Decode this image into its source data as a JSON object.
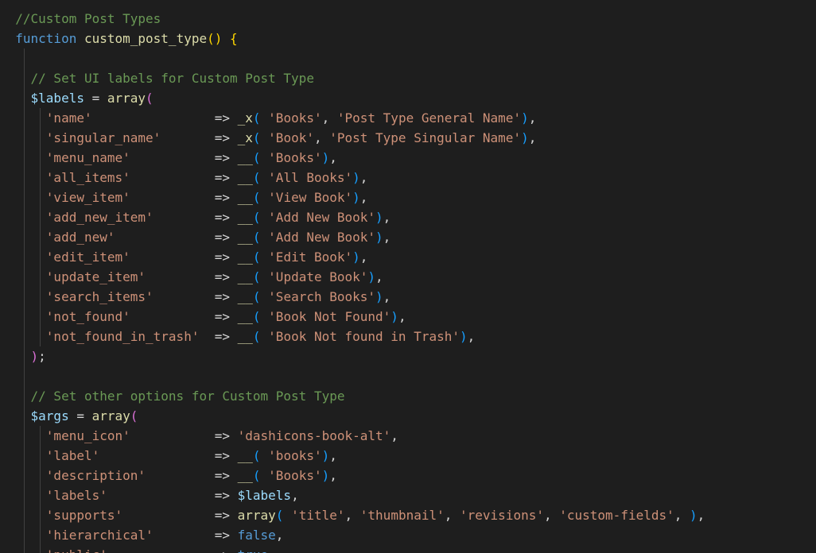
{
  "colors": {
    "background": "#1e1e1e",
    "comment": "#6a9955",
    "keyword": "#569cd6",
    "function": "#dcdcaa",
    "string": "#ce9178",
    "variable": "#9cdcfe",
    "plain": "#d4d4d4",
    "bracket_level1": "#ffd700",
    "bracket_level2": "#da70d6",
    "bracket_level3": "#179fff",
    "indent_guide": "#404040"
  },
  "lines": [
    {
      "guides": 0,
      "tokens": [
        {
          "t": "  "
        },
        {
          "t": "//Custom Post Types",
          "c": "comment"
        }
      ]
    },
    {
      "guides": 0,
      "tokens": [
        {
          "t": "  "
        },
        {
          "t": "function",
          "c": "kw"
        },
        {
          "t": " "
        },
        {
          "t": "custom_post_type",
          "c": "fn"
        },
        {
          "t": "()",
          "c": "b1"
        },
        {
          "t": " "
        },
        {
          "t": "{",
          "c": "b1"
        }
      ]
    },
    {
      "guides": 1,
      "tokens": [
        {
          "t": ""
        }
      ]
    },
    {
      "guides": 1,
      "tokens": [
        {
          "t": "    "
        },
        {
          "t": "// Set UI labels for Custom Post Type",
          "c": "comment"
        }
      ]
    },
    {
      "guides": 1,
      "tokens": [
        {
          "t": "    "
        },
        {
          "t": "$labels",
          "c": "var"
        },
        {
          "t": " = "
        },
        {
          "t": "array",
          "c": "fn"
        },
        {
          "t": "(",
          "c": "b2"
        }
      ]
    },
    {
      "guides": 2,
      "tokens": [
        {
          "t": "      "
        },
        {
          "t": "'name'",
          "c": "str"
        },
        {
          "t": "                => "
        },
        {
          "t": "_x",
          "c": "fn"
        },
        {
          "t": "(",
          "c": "b3"
        },
        {
          "t": " "
        },
        {
          "t": "'Books'",
          "c": "str"
        },
        {
          "t": ", "
        },
        {
          "t": "'Post Type General Name'",
          "c": "str"
        },
        {
          "t": ")",
          "c": "b3"
        },
        {
          "t": ","
        }
      ]
    },
    {
      "guides": 2,
      "tokens": [
        {
          "t": "      "
        },
        {
          "t": "'singular_name'",
          "c": "str"
        },
        {
          "t": "       => "
        },
        {
          "t": "_x",
          "c": "fn"
        },
        {
          "t": "(",
          "c": "b3"
        },
        {
          "t": " "
        },
        {
          "t": "'Book'",
          "c": "str"
        },
        {
          "t": ", "
        },
        {
          "t": "'Post Type Singular Name'",
          "c": "str"
        },
        {
          "t": ")",
          "c": "b3"
        },
        {
          "t": ","
        }
      ]
    },
    {
      "guides": 2,
      "tokens": [
        {
          "t": "      "
        },
        {
          "t": "'menu_name'",
          "c": "str"
        },
        {
          "t": "           => "
        },
        {
          "t": "__",
          "c": "fn"
        },
        {
          "t": "(",
          "c": "b3"
        },
        {
          "t": " "
        },
        {
          "t": "'Books'",
          "c": "str"
        },
        {
          "t": ")",
          "c": "b3"
        },
        {
          "t": ","
        }
      ]
    },
    {
      "guides": 2,
      "tokens": [
        {
          "t": "      "
        },
        {
          "t": "'all_items'",
          "c": "str"
        },
        {
          "t": "           => "
        },
        {
          "t": "__",
          "c": "fn"
        },
        {
          "t": "(",
          "c": "b3"
        },
        {
          "t": " "
        },
        {
          "t": "'All Books'",
          "c": "str"
        },
        {
          "t": ")",
          "c": "b3"
        },
        {
          "t": ","
        }
      ]
    },
    {
      "guides": 2,
      "tokens": [
        {
          "t": "      "
        },
        {
          "t": "'view_item'",
          "c": "str"
        },
        {
          "t": "           => "
        },
        {
          "t": "__",
          "c": "fn"
        },
        {
          "t": "(",
          "c": "b3"
        },
        {
          "t": " "
        },
        {
          "t": "'View Book'",
          "c": "str"
        },
        {
          "t": ")",
          "c": "b3"
        },
        {
          "t": ","
        }
      ]
    },
    {
      "guides": 2,
      "tokens": [
        {
          "t": "      "
        },
        {
          "t": "'add_new_item'",
          "c": "str"
        },
        {
          "t": "        => "
        },
        {
          "t": "__",
          "c": "fn"
        },
        {
          "t": "(",
          "c": "b3"
        },
        {
          "t": " "
        },
        {
          "t": "'Add New Book'",
          "c": "str"
        },
        {
          "t": ")",
          "c": "b3"
        },
        {
          "t": ","
        }
      ]
    },
    {
      "guides": 2,
      "tokens": [
        {
          "t": "      "
        },
        {
          "t": "'add_new'",
          "c": "str"
        },
        {
          "t": "             => "
        },
        {
          "t": "__",
          "c": "fn"
        },
        {
          "t": "(",
          "c": "b3"
        },
        {
          "t": " "
        },
        {
          "t": "'Add New Book'",
          "c": "str"
        },
        {
          "t": ")",
          "c": "b3"
        },
        {
          "t": ","
        }
      ]
    },
    {
      "guides": 2,
      "tokens": [
        {
          "t": "      "
        },
        {
          "t": "'edit_item'",
          "c": "str"
        },
        {
          "t": "           => "
        },
        {
          "t": "__",
          "c": "fn"
        },
        {
          "t": "(",
          "c": "b3"
        },
        {
          "t": " "
        },
        {
          "t": "'Edit Book'",
          "c": "str"
        },
        {
          "t": ")",
          "c": "b3"
        },
        {
          "t": ","
        }
      ]
    },
    {
      "guides": 2,
      "tokens": [
        {
          "t": "      "
        },
        {
          "t": "'update_item'",
          "c": "str"
        },
        {
          "t": "         => "
        },
        {
          "t": "__",
          "c": "fn"
        },
        {
          "t": "(",
          "c": "b3"
        },
        {
          "t": " "
        },
        {
          "t": "'Update Book'",
          "c": "str"
        },
        {
          "t": ")",
          "c": "b3"
        },
        {
          "t": ","
        }
      ]
    },
    {
      "guides": 2,
      "tokens": [
        {
          "t": "      "
        },
        {
          "t": "'search_items'",
          "c": "str"
        },
        {
          "t": "        => "
        },
        {
          "t": "__",
          "c": "fn"
        },
        {
          "t": "(",
          "c": "b3"
        },
        {
          "t": " "
        },
        {
          "t": "'Search Books'",
          "c": "str"
        },
        {
          "t": ")",
          "c": "b3"
        },
        {
          "t": ","
        }
      ]
    },
    {
      "guides": 2,
      "tokens": [
        {
          "t": "      "
        },
        {
          "t": "'not_found'",
          "c": "str"
        },
        {
          "t": "           => "
        },
        {
          "t": "__",
          "c": "fn"
        },
        {
          "t": "(",
          "c": "b3"
        },
        {
          "t": " "
        },
        {
          "t": "'Book Not Found'",
          "c": "str"
        },
        {
          "t": ")",
          "c": "b3"
        },
        {
          "t": ","
        }
      ]
    },
    {
      "guides": 2,
      "tokens": [
        {
          "t": "      "
        },
        {
          "t": "'not_found_in_trash'",
          "c": "str"
        },
        {
          "t": "  => "
        },
        {
          "t": "__",
          "c": "fn"
        },
        {
          "t": "(",
          "c": "b3"
        },
        {
          "t": " "
        },
        {
          "t": "'Book Not found in Trash'",
          "c": "str"
        },
        {
          "t": ")",
          "c": "b3"
        },
        {
          "t": ","
        }
      ]
    },
    {
      "guides": 1,
      "tokens": [
        {
          "t": "    "
        },
        {
          "t": ")",
          "c": "b2"
        },
        {
          "t": ";"
        }
      ]
    },
    {
      "guides": 1,
      "tokens": [
        {
          "t": ""
        }
      ]
    },
    {
      "guides": 1,
      "tokens": [
        {
          "t": "    "
        },
        {
          "t": "// Set other options for Custom Post Type",
          "c": "comment"
        }
      ]
    },
    {
      "guides": 1,
      "tokens": [
        {
          "t": "    "
        },
        {
          "t": "$args",
          "c": "var"
        },
        {
          "t": " = "
        },
        {
          "t": "array",
          "c": "fn"
        },
        {
          "t": "(",
          "c": "b2"
        }
      ]
    },
    {
      "guides": 2,
      "tokens": [
        {
          "t": "      "
        },
        {
          "t": "'menu_icon'",
          "c": "str"
        },
        {
          "t": "           => "
        },
        {
          "t": "'dashicons-book-alt'",
          "c": "str"
        },
        {
          "t": ","
        }
      ]
    },
    {
      "guides": 2,
      "tokens": [
        {
          "t": "      "
        },
        {
          "t": "'label'",
          "c": "str"
        },
        {
          "t": "               => "
        },
        {
          "t": "__",
          "c": "fn"
        },
        {
          "t": "(",
          "c": "b3"
        },
        {
          "t": " "
        },
        {
          "t": "'books'",
          "c": "str"
        },
        {
          "t": ")",
          "c": "b3"
        },
        {
          "t": ","
        }
      ]
    },
    {
      "guides": 2,
      "tokens": [
        {
          "t": "      "
        },
        {
          "t": "'description'",
          "c": "str"
        },
        {
          "t": "         => "
        },
        {
          "t": "__",
          "c": "fn"
        },
        {
          "t": "(",
          "c": "b3"
        },
        {
          "t": " "
        },
        {
          "t": "'Books'",
          "c": "str"
        },
        {
          "t": ")",
          "c": "b3"
        },
        {
          "t": ","
        }
      ]
    },
    {
      "guides": 2,
      "tokens": [
        {
          "t": "      "
        },
        {
          "t": "'labels'",
          "c": "str"
        },
        {
          "t": "              => "
        },
        {
          "t": "$labels",
          "c": "var"
        },
        {
          "t": ","
        }
      ]
    },
    {
      "guides": 2,
      "tokens": [
        {
          "t": "      "
        },
        {
          "t": "'supports'",
          "c": "str"
        },
        {
          "t": "            => "
        },
        {
          "t": "array",
          "c": "fn"
        },
        {
          "t": "(",
          "c": "b3"
        },
        {
          "t": " "
        },
        {
          "t": "'title'",
          "c": "str"
        },
        {
          "t": ", "
        },
        {
          "t": "'thumbnail'",
          "c": "str"
        },
        {
          "t": ", "
        },
        {
          "t": "'revisions'",
          "c": "str"
        },
        {
          "t": ", "
        },
        {
          "t": "'custom-fields'",
          "c": "str"
        },
        {
          "t": ", "
        },
        {
          "t": ")",
          "c": "b3"
        },
        {
          "t": ","
        }
      ]
    },
    {
      "guides": 2,
      "tokens": [
        {
          "t": "      "
        },
        {
          "t": "'hierarchical'",
          "c": "str"
        },
        {
          "t": "        => "
        },
        {
          "t": "false",
          "c": "kw"
        },
        {
          "t": ","
        }
      ]
    },
    {
      "guides": 2,
      "tokens": [
        {
          "t": "      "
        },
        {
          "t": "'public'",
          "c": "str"
        },
        {
          "t": "              => "
        },
        {
          "t": "true",
          "c": "kw"
        },
        {
          "t": ","
        }
      ]
    }
  ]
}
